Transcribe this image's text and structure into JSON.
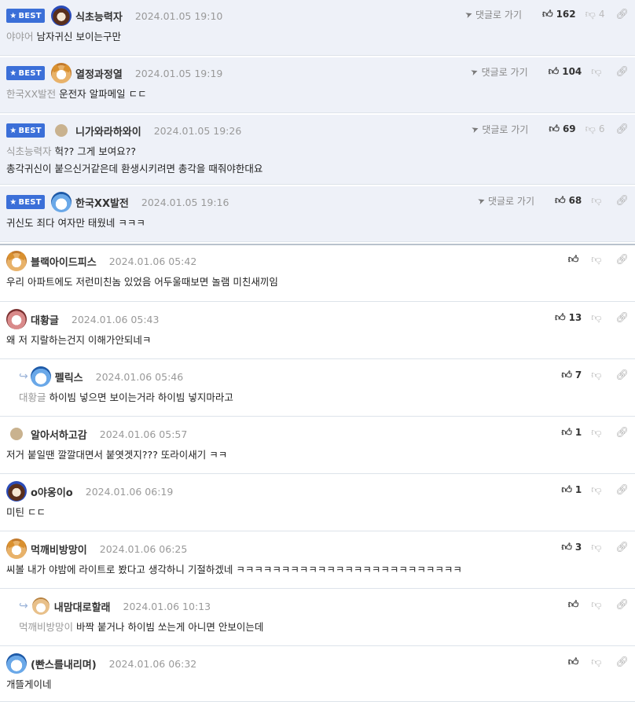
{
  "ui": {
    "best_badge": "BEST",
    "goto_reply": "댓글로 가기",
    "colors": {
      "best_bg": "#eef1f8",
      "badge": "#3b6fd8",
      "date": "#999999"
    }
  },
  "comments": [
    {
      "best": true,
      "avatar": "dark",
      "nick": "식초능력자",
      "date": "2024.01.05 19:10",
      "up": "162",
      "down": "4",
      "lines": [
        {
          "mention": "야야어",
          "text": "남자귀신 보이는구만"
        }
      ]
    },
    {
      "best": true,
      "avatar": "dog",
      "nick": "열정과정열",
      "date": "2024.01.05 19:19",
      "up": "104",
      "down": "",
      "lines": [
        {
          "mention": "한국XX발전",
          "text": "운전자 알파메일 ㄷㄷ"
        }
      ]
    },
    {
      "best": true,
      "avatar": "tan",
      "nick": "니가와라하와이",
      "date": "2024.01.05 19:26",
      "up": "69",
      "down": "6",
      "lines": [
        {
          "mention": "식초능력자",
          "text": "헉?? 그게 보여요??"
        },
        {
          "mention": "",
          "text": "총각귀신이 붙으신거같은데 환생시키려면 총각을 때줘야한대요"
        }
      ]
    },
    {
      "best": true,
      "avatar": "blue",
      "nick": "한국XX발전",
      "date": "2024.01.05 19:16",
      "up": "68",
      "down": "",
      "lines": [
        {
          "mention": "",
          "text": "귀신도 죄다 여자만 태웠네 ㅋㅋㅋ"
        }
      ]
    },
    {
      "best": false,
      "avatar": "dog",
      "nick": "블랙아이드피스",
      "date": "2024.01.06 05:42",
      "up": "",
      "down": "",
      "lines": [
        {
          "mention": "",
          "text": "우리 아파트에도 저런미친놈 있었음 어두울때보면 놀램 미친새끼임"
        }
      ]
    },
    {
      "best": false,
      "avatar": "pink",
      "nick": "대황글",
      "date": "2024.01.06 05:43",
      "up": "13",
      "down": "",
      "lines": [
        {
          "mention": "",
          "text": "왜 저 지랄하는건지 이해가안되네ㅋ"
        }
      ]
    },
    {
      "best": false,
      "reply": true,
      "avatar": "blue",
      "nick": "펠릭스",
      "date": "2024.01.06 05:46",
      "up": "7",
      "down": "",
      "lines": [
        {
          "mention": "대황글",
          "text": "하이빔 넣으면 보이는거라 하이빔 넣지마라고"
        }
      ]
    },
    {
      "best": false,
      "avatar": "tan",
      "nick": "알아서하고감",
      "date": "2024.01.06 05:57",
      "up": "1",
      "down": "",
      "lines": [
        {
          "mention": "",
          "text": "저거 붙일땐 깔깔대면서 붙엿겟지??? 또라이새기 ㅋㅋ"
        }
      ]
    },
    {
      "best": false,
      "avatar": "dark",
      "nick": "o야옹이o",
      "date": "2024.01.06 06:19",
      "up": "1",
      "down": "",
      "lines": [
        {
          "mention": "",
          "text": "미틴 ㄷㄷ"
        }
      ]
    },
    {
      "best": false,
      "avatar": "dog",
      "nick": "먹깨비방망이",
      "date": "2024.01.06 06:25",
      "up": "3",
      "down": "",
      "lines": [
        {
          "mention": "",
          "text": "씨볼 내가 야밤에 라이트로 봤다고 생각하니 기절하겠네 ㅋㅋㅋㅋㅋㅋㅋㅋㅋㅋㅋㅋㅋㅋㅋㅋㅋㅋㅋㅋㅋㅋㅋㅋㅋ"
        }
      ]
    },
    {
      "best": false,
      "reply": true,
      "avatar": "pup",
      "nick": "내맘대로할래",
      "date": "2024.01.06 10:13",
      "up": "",
      "down": "",
      "lines": [
        {
          "mention": "먹깨비방망이",
          "text": "바짝 붙거나 하이빔 쏘는게 아니면 안보이는데"
        }
      ]
    },
    {
      "best": false,
      "avatar": "blue",
      "nick": "(빤스를내리며)",
      "date": "2024.01.06 06:32",
      "up": "",
      "down": "",
      "lines": [
        {
          "mention": "",
          "text": "개뜰게이네"
        }
      ]
    }
  ]
}
